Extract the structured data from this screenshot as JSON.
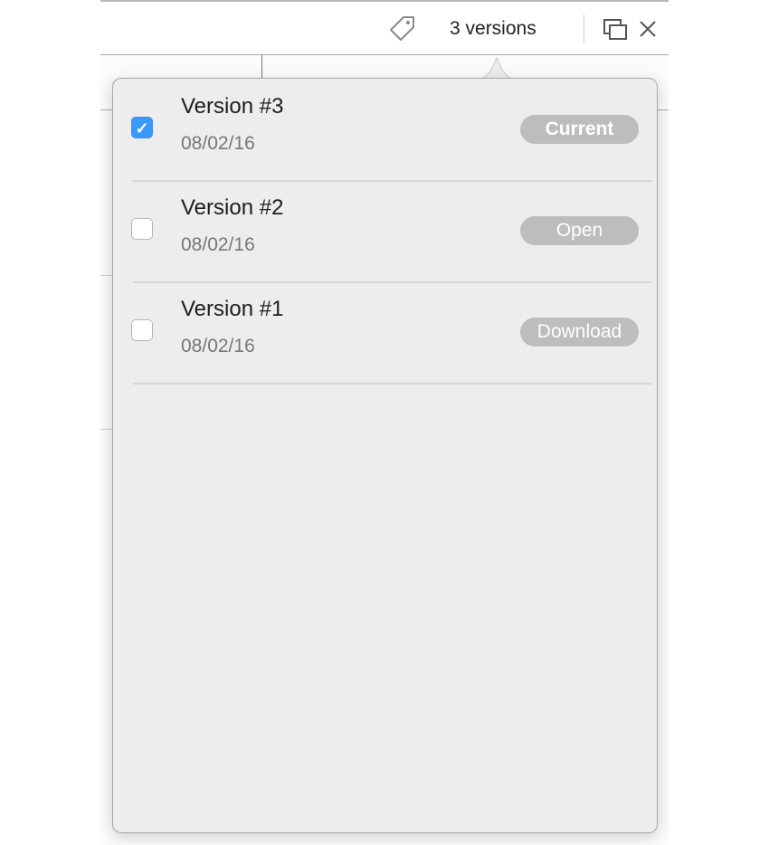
{
  "header": {
    "versions_count": "3 versions"
  },
  "versions": [
    {
      "name": "Version #3",
      "date": "08/02/16",
      "action": "Current",
      "checked": true
    },
    {
      "name": "Version #2",
      "date": "08/02/16",
      "action": "Open",
      "checked": false
    },
    {
      "name": "Version #1",
      "date": "08/02/16",
      "action": "Download",
      "checked": false
    }
  ],
  "colors": {
    "accent": "#3b99fc",
    "pill": "#bdbdbd",
    "popover_bg": "#ededed"
  }
}
